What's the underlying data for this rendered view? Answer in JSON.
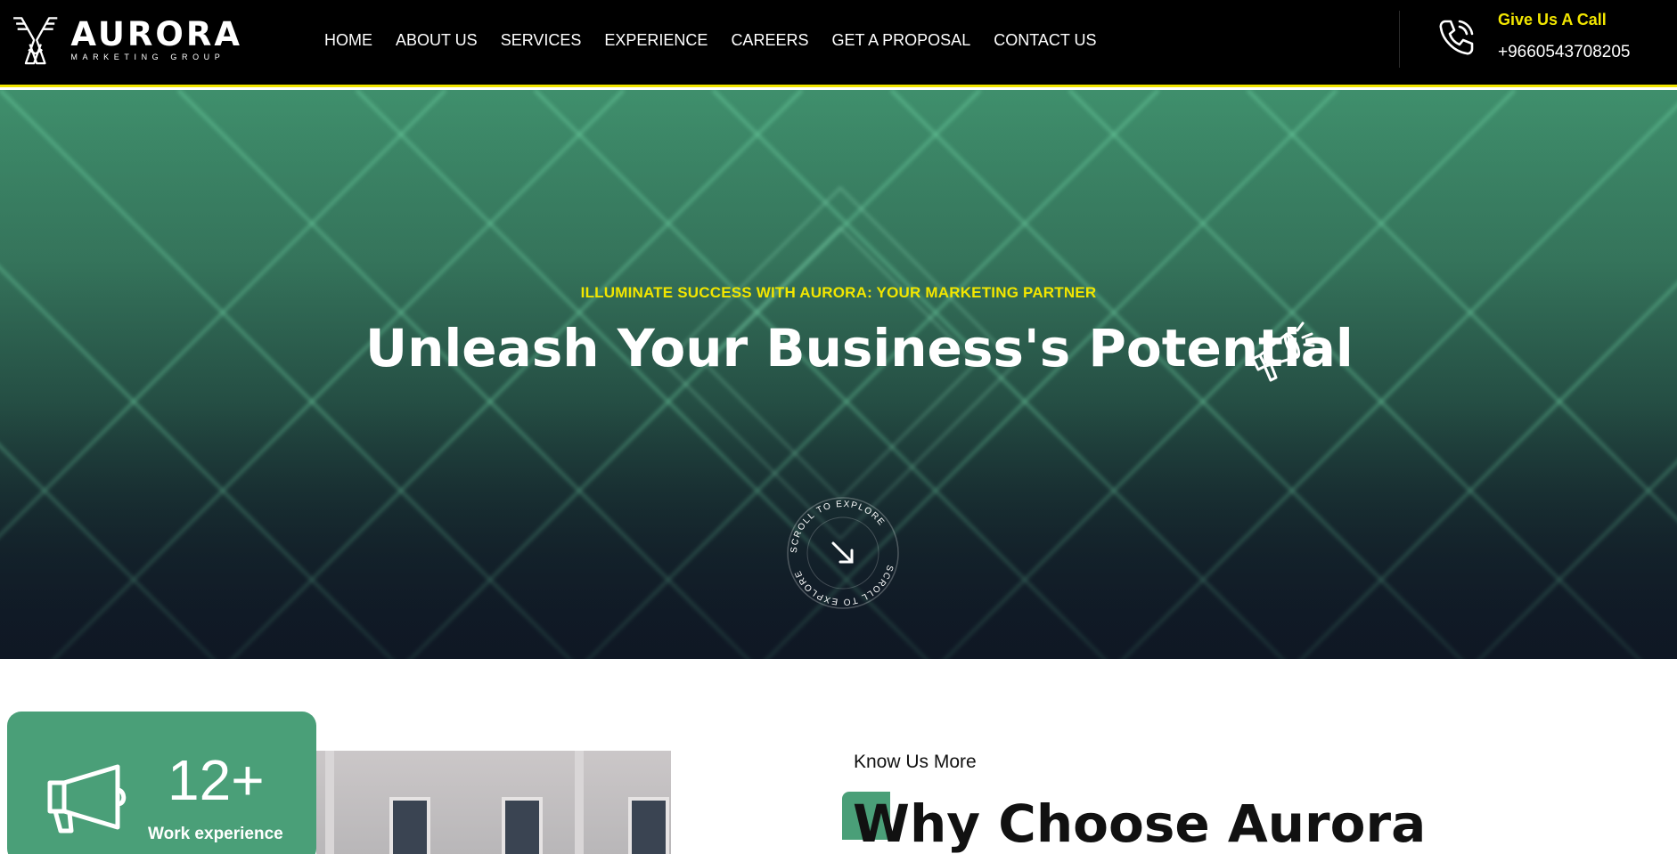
{
  "brand": {
    "name": "AURORA",
    "tagline": "MARKETING GROUP"
  },
  "nav": {
    "items": [
      {
        "label": "HOME"
      },
      {
        "label": "ABOUT US"
      },
      {
        "label": "SERVICES"
      },
      {
        "label": "EXPERIENCE"
      },
      {
        "label": "CAREERS"
      },
      {
        "label": "GET A PROPOSAL"
      },
      {
        "label": "CONTACT US"
      }
    ]
  },
  "contact": {
    "title": "Give Us A Call",
    "phone": "+9660543708205",
    "icon": "phone-icon"
  },
  "hero": {
    "eyebrow": "ILLUMINATE SUCCESS WITH AURORA: YOUR MARKETING PARTNER",
    "title": "Unleash Your Business's Potential",
    "icon": "megaphone-icon",
    "scroll_text": "SCROLL TO EXPLORE"
  },
  "stat": {
    "number": "12+",
    "label": "Work experience",
    "icon": "megaphone-icon"
  },
  "about": {
    "eyebrow": "Know Us More",
    "title": "Why Choose Aurora"
  },
  "colors": {
    "accent_yellow": "#f2e600",
    "brand_green": "#4a9f78",
    "header_bg": "#000000"
  }
}
